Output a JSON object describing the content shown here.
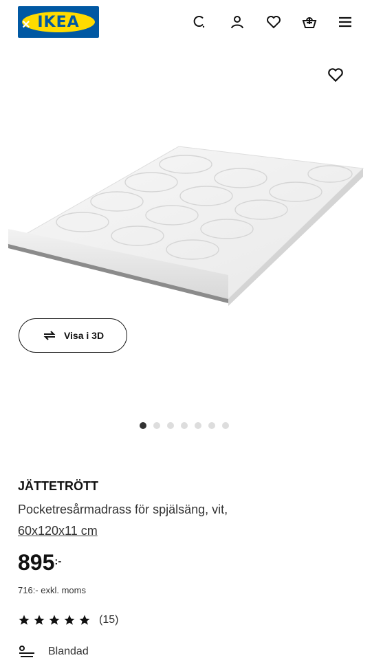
{
  "header": {
    "logo_text": "IKEA",
    "logo_overlay": "×",
    "icons": [
      "search-icon",
      "user-icon",
      "heart-icon",
      "cart-icon",
      "menu-icon"
    ]
  },
  "gallery": {
    "view_3d_label": "Visa i 3D",
    "total_images": 7,
    "active_index": 0
  },
  "product": {
    "name": "JÄTTETRÖTT",
    "description": "Pocketresårmadrass för spjälsäng, vit,",
    "size": "60x120x11 cm",
    "price": "895",
    "price_suffix": ":-",
    "excl_vat": "716:- exkl. moms",
    "rating_stars": 5,
    "review_count": "(15)",
    "feature_label": "Blandad"
  },
  "colors": {
    "brand_blue": "#0058a3",
    "brand_yellow": "#ffdb00"
  }
}
